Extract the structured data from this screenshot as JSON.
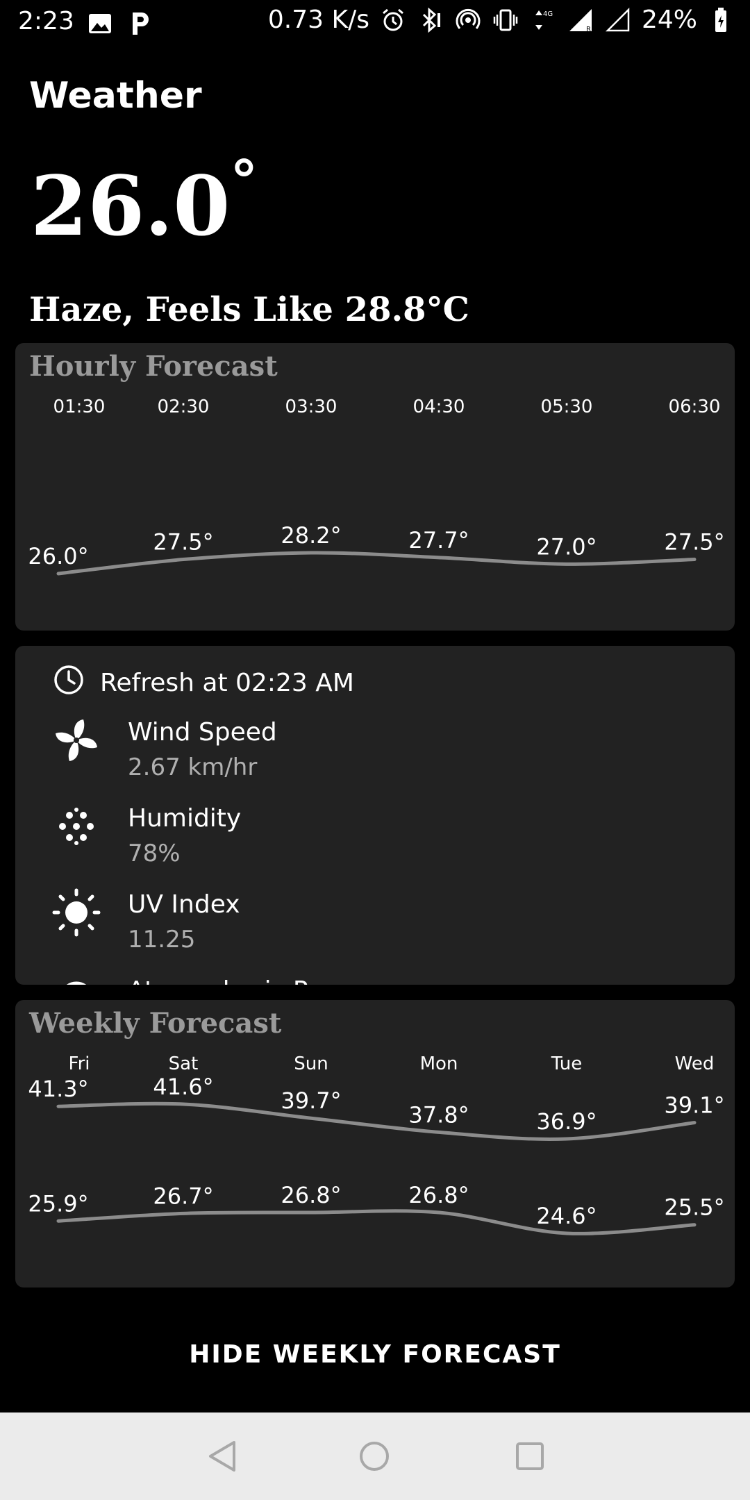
{
  "status_bar": {
    "time": "2:23",
    "speed": "0.73 K/s",
    "battery": "24%",
    "left_icons": [
      "image-icon",
      "parking-icon"
    ],
    "right_icons": [
      "alarm-icon",
      "bluetooth-icon",
      "hotspot-icon",
      "vibrate-icon",
      "data-arrows-icon",
      "signal-icon",
      "signal-empty-icon",
      "battery-icon"
    ]
  },
  "app": {
    "title": "Weather",
    "current_temp": "26.0",
    "degree_symbol": "°",
    "condition": "Haze, Feels Like 28.8°C"
  },
  "hourly": {
    "title": "Hourly Forecast",
    "times": [
      "01:30",
      "02:30",
      "03:30",
      "04:30",
      "05:30",
      "06:30"
    ],
    "temps": [
      "26.0°",
      "27.5°",
      "28.2°",
      "27.7°",
      "27.0°",
      "27.5°"
    ]
  },
  "details": {
    "refresh": "Refresh at 02:23 AM",
    "items": [
      {
        "label": "Wind Speed",
        "value": "2.67 km/hr",
        "icon": "fan-icon"
      },
      {
        "label": "Humidity",
        "value": "78%",
        "icon": "humidity-dots-icon"
      },
      {
        "label": "UV Index",
        "value": "11.25",
        "icon": "sun-icon"
      },
      {
        "label": "Atmospheric P",
        "value": "",
        "icon": "pressure-icon"
      }
    ]
  },
  "weekly": {
    "title": "Weekly Forecast",
    "days": [
      "Fri",
      "Sat",
      "Sun",
      "Mon",
      "Tue",
      "Wed"
    ],
    "highs": [
      "41.3°",
      "41.6°",
      "39.7°",
      "37.8°",
      "36.9°",
      "39.1°"
    ],
    "lows": [
      "25.9°",
      "26.7°",
      "26.8°",
      "26.8°",
      "24.6°",
      "25.5°"
    ]
  },
  "chart_data": [
    {
      "type": "line",
      "title": "Hourly Forecast",
      "categories": [
        "01:30",
        "02:30",
        "03:30",
        "04:30",
        "05:30",
        "06:30"
      ],
      "series": [
        {
          "values": [
            26.0,
            27.5,
            28.2,
            27.7,
            27.0,
            27.5
          ]
        }
      ],
      "ylim": [
        20,
        32
      ]
    },
    {
      "type": "line",
      "title": "Weekly Forecast",
      "categories": [
        "Fri",
        "Sat",
        "Sun",
        "Mon",
        "Tue",
        "Wed"
      ],
      "series": [
        {
          "values": [
            41.3,
            41.6,
            39.7,
            37.8,
            36.9,
            39.1
          ]
        },
        {
          "values": [
            25.9,
            26.7,
            26.8,
            26.8,
            24.6,
            25.5
          ]
        }
      ]
    }
  ],
  "footer": {
    "hide_button": "HIDE WEEKLY FORECAST"
  },
  "colors": {
    "background": "#000000",
    "card": "#222222",
    "line": "#8c8c8c",
    "nav_bar": "#ebebeb"
  }
}
